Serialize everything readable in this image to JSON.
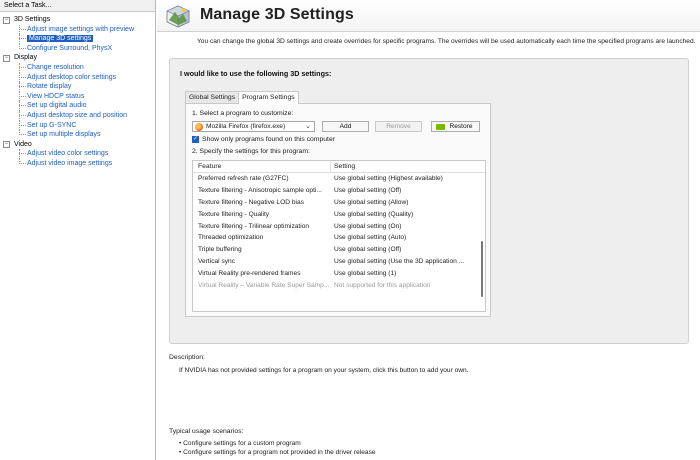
{
  "left_pane": {
    "title": "Select a Task...",
    "tree": [
      {
        "type": "cat",
        "label": "3D Settings",
        "expander": "−"
      },
      {
        "type": "child",
        "label": "Adjust image settings with preview"
      },
      {
        "type": "child",
        "label": "Manage 3D settings",
        "selected": true
      },
      {
        "type": "child",
        "label": "Configure Surround, PhysX",
        "last": true
      },
      {
        "type": "cat",
        "label": "Display",
        "expander": "−"
      },
      {
        "type": "child",
        "label": "Change resolution"
      },
      {
        "type": "child",
        "label": "Adjust desktop color settings"
      },
      {
        "type": "child",
        "label": "Rotate display"
      },
      {
        "type": "child",
        "label": "View HDCP status"
      },
      {
        "type": "child",
        "label": "Set up digital audio"
      },
      {
        "type": "child",
        "label": "Adjust desktop size and position"
      },
      {
        "type": "child",
        "label": "Set up G-SYNC"
      },
      {
        "type": "child",
        "label": "Set up multiple displays",
        "last": true
      },
      {
        "type": "cat",
        "label": "Video",
        "expander": "−"
      },
      {
        "type": "child",
        "label": "Adjust video color settings"
      },
      {
        "type": "child",
        "label": "Adjust video image settings",
        "last": true
      }
    ]
  },
  "header": {
    "title": "Manage 3D Settings",
    "icon": "nvidia-3d-cube-icon"
  },
  "intro": "You can change the global 3D settings and create overrides for specific programs. The overrides will be used automatically each time the specified programs are launched.",
  "settings": {
    "heading": "I would like to use the following 3D settings:",
    "tabs": [
      {
        "label": "Global Settings",
        "active": false
      },
      {
        "label": "Program Settings",
        "active": true
      }
    ],
    "step1_label": "1. Select a program to customize:",
    "program_value": "Mozilla Firefox (firefox.exe)",
    "add_label": "Add",
    "remove_label": "Remove",
    "restore_label": "Restore",
    "show_only_label": "Show only programs found on this computer",
    "step2_label": "2. Specify the settings for this program:",
    "columns": {
      "feature": "Feature",
      "setting": "Setting"
    },
    "rows": [
      {
        "feature": "Preferred refresh rate (G27FC)",
        "setting": "Use global setting (Highest available)"
      },
      {
        "feature": "Texture filtering - Anisotropic sample opti...",
        "setting": "Use global setting (Off)"
      },
      {
        "feature": "Texture filtering - Negative LOD bias",
        "setting": "Use global setting (Allow)"
      },
      {
        "feature": "Texture filtering - Quality",
        "setting": "Use global setting (Quality)"
      },
      {
        "feature": "Texture filtering - Trilinear optimization",
        "setting": "Use global setting (On)"
      },
      {
        "feature": "Threaded optimization",
        "setting": "Use global setting (Auto)"
      },
      {
        "feature": "Triple buffering",
        "setting": "Use global setting (Off)"
      },
      {
        "feature": "Vertical sync",
        "setting": "Use global setting (Use the 3D application ..."
      },
      {
        "feature": "Virtual Reality pre-rendered frames",
        "setting": "Use global setting (1)"
      },
      {
        "feature": "Virtual Reality – Variable Rate Super Samp...",
        "setting": "Not supported for this application",
        "dim": true
      }
    ]
  },
  "description": {
    "label": "Description:",
    "text": "If NVIDIA has not provided settings for a program on your system, click this button to add your own."
  },
  "usage": {
    "label": "Typical usage scenarios:",
    "items": [
      "Configure settings for a custom program",
      "Configure settings for a program not provided in the driver release"
    ]
  }
}
